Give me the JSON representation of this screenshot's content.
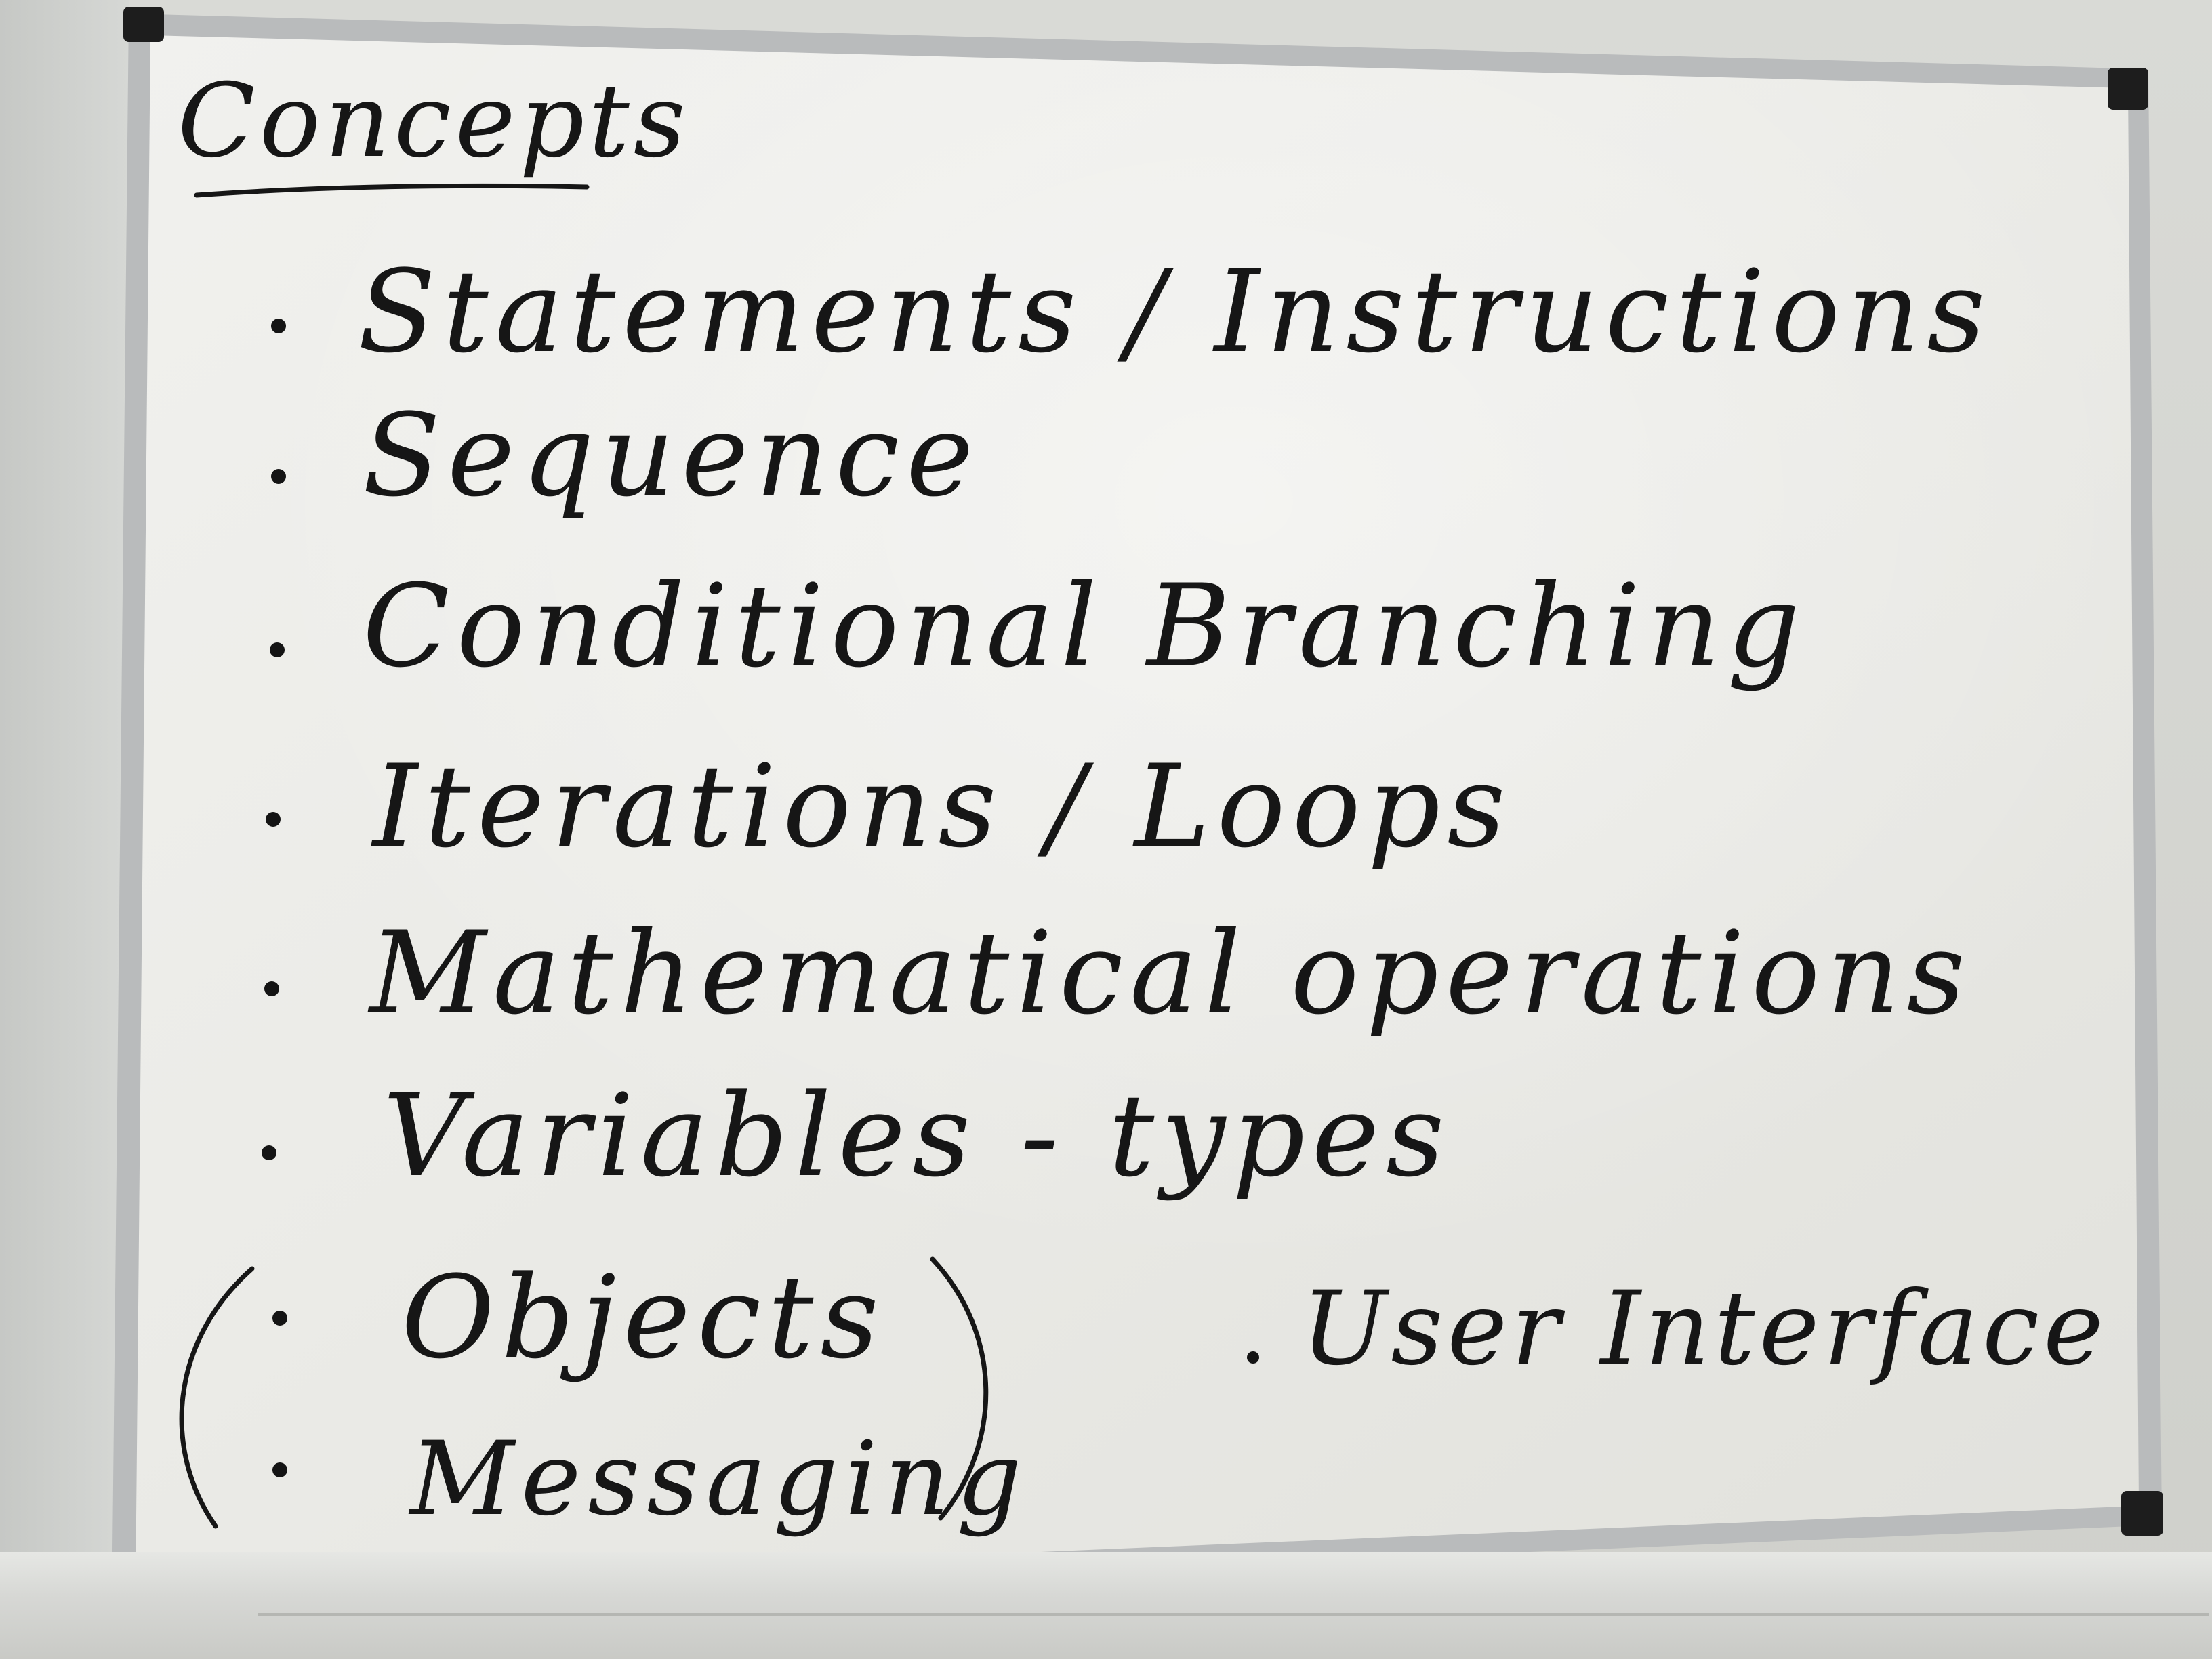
{
  "whiteboard": {
    "heading": "Concepts",
    "items": [
      {
        "text": "Statements / Instructions"
      },
      {
        "text": "Sequence"
      },
      {
        "text": "Conditional Branching"
      },
      {
        "text": "Iterations / Loops"
      },
      {
        "text": "Mathematical operations"
      },
      {
        "text": "Variables - types"
      }
    ],
    "bracketed_items": [
      {
        "text": "Objects"
      },
      {
        "text": "Messaging"
      }
    ],
    "side_item": {
      "text": "User Interface"
    }
  },
  "colors": {
    "marker": "#161616",
    "board": "#efefeb",
    "frame": "#b8babb"
  }
}
